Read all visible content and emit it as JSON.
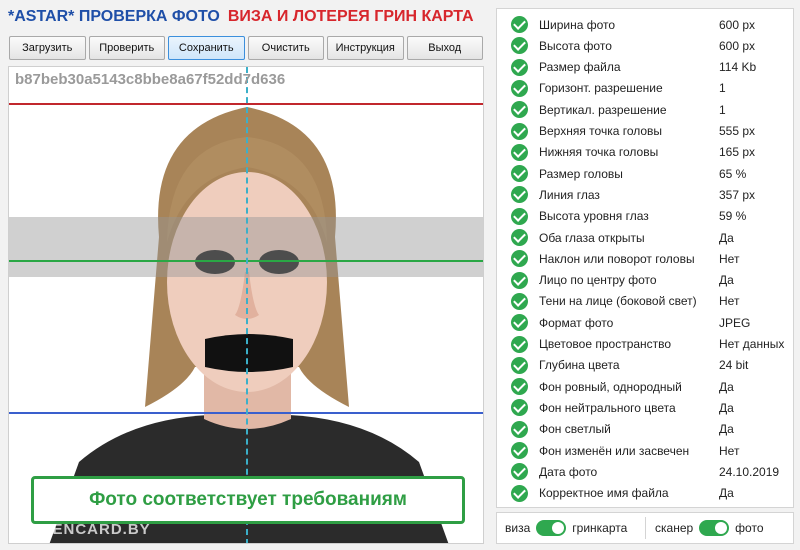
{
  "header": {
    "title_part1": "*ASTAR* ПРОВЕРКА ФОТО",
    "title_part2": "ВИЗА И ЛОТЕРЕЯ ГРИН КАРТА"
  },
  "toolbar": {
    "load": "Загрузить",
    "check": "Проверить",
    "save": "Сохранить",
    "clear": "Очистить",
    "instructions": "Инструкция",
    "exit": "Выход"
  },
  "photo": {
    "hash": "b87beb30a5143c8bbe8a67f52dd7d636",
    "verdict": "Фото соответствует требованиям",
    "watermark": "GREENCARD.BY"
  },
  "checks": [
    {
      "label": "Ширина фото",
      "value": "600 px"
    },
    {
      "label": "Высота фото",
      "value": "600 px"
    },
    {
      "label": "Размер файла",
      "value": "114 Kb"
    },
    {
      "label": "Горизонт. разрешение",
      "value": "1"
    },
    {
      "label": "Вертикал. разрешение",
      "value": "1"
    },
    {
      "label": "Верхняя точка головы",
      "value": "555 px"
    },
    {
      "label": "Нижняя точка головы",
      "value": "165 px"
    },
    {
      "label": "Размер головы",
      "value": "65 %"
    },
    {
      "label": "Линия глаз",
      "value": "357 px"
    },
    {
      "label": "Высота уровня глаз",
      "value": "59 %"
    },
    {
      "label": "Оба глаза открыты",
      "value": "Да"
    },
    {
      "label": "Наклон или поворот головы",
      "value": "Нет"
    },
    {
      "label": "Лицо по центру фото",
      "value": "Да"
    },
    {
      "label": "Тени на лице (боковой свет)",
      "value": "Нет"
    },
    {
      "label": "Формат фото",
      "value": "JPEG"
    },
    {
      "label": "Цветовое пространство",
      "value": "Нет данных"
    },
    {
      "label": "Глубина цвета",
      "value": "24 bit"
    },
    {
      "label": "Фон ровный, однородный",
      "value": "Да"
    },
    {
      "label": "Фон нейтрального цвета",
      "value": "Да"
    },
    {
      "label": "Фон светлый",
      "value": "Да"
    },
    {
      "label": "Фон изменён или засвечен",
      "value": "Нет"
    },
    {
      "label": "Дата фото",
      "value": "24.10.2019"
    },
    {
      "label": "Корректное имя файла",
      "value": "Да"
    }
  ],
  "switches": {
    "left_label": "виза",
    "right_label": "гринкарта",
    "left2_label": "сканер",
    "right2_label": "фото"
  },
  "colors": {
    "title_blue": "#1f4fa8",
    "title_red": "#d7262c",
    "ok_green": "#2fa84f",
    "line_top": "#c1272d",
    "line_eye": "#2aa745",
    "line_bottom": "#3a5fcd"
  }
}
